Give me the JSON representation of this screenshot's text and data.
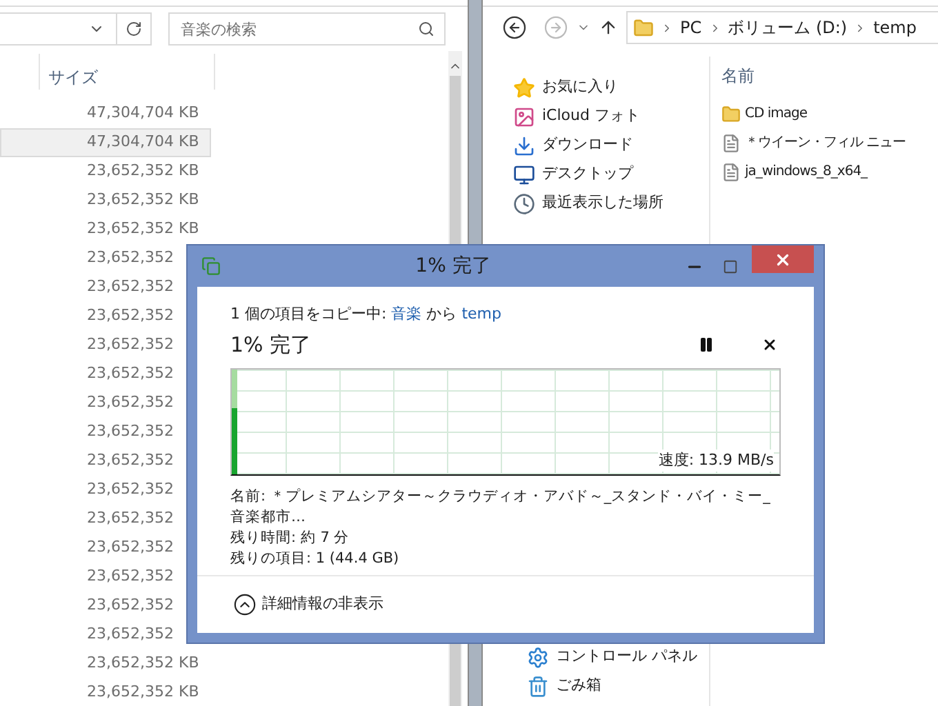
{
  "left_window": {
    "search": {
      "placeholder": "音楽の検索"
    },
    "column": "サイズ",
    "rows": [
      {
        "size": "47,304,704 KB",
        "selected": false
      },
      {
        "size": "47,304,704 KB",
        "selected": true
      },
      {
        "size": "23,652,352 KB",
        "selected": false
      },
      {
        "size": "23,652,352 KB",
        "selected": false
      },
      {
        "size": "23,652,352 KB",
        "selected": false
      },
      {
        "size": "23,652,352",
        "selected": false
      },
      {
        "size": "23,652,352",
        "selected": false
      },
      {
        "size": "23,652,352",
        "selected": false
      },
      {
        "size": "23,652,352",
        "selected": false
      },
      {
        "size": "23,652,352",
        "selected": false
      },
      {
        "size": "23,652,352",
        "selected": false
      },
      {
        "size": "23,652,352",
        "selected": false
      },
      {
        "size": "23,652,352",
        "selected": false
      },
      {
        "size": "23,652,352",
        "selected": false
      },
      {
        "size": "23,652,352",
        "selected": false
      },
      {
        "size": "23,652,352",
        "selected": false
      },
      {
        "size": "23,652,352",
        "selected": false
      },
      {
        "size": "23,652,352",
        "selected": false
      },
      {
        "size": "23,652,352",
        "selected": false
      },
      {
        "size": "23,652,352 KB",
        "selected": false
      },
      {
        "size": "23,652,352 KB",
        "selected": false
      }
    ]
  },
  "right_window": {
    "breadcrumb": [
      "PC",
      "ボリューム (D:)",
      "temp"
    ],
    "column": "名前",
    "nav_top": [
      {
        "label": "お気に入り",
        "kind": "star"
      },
      {
        "label": "iCloud フォト",
        "kind": "photos"
      },
      {
        "label": "ダウンロード",
        "kind": "download"
      },
      {
        "label": "デスクトップ",
        "kind": "desktop"
      },
      {
        "label": "最近表示した場所",
        "kind": "recent"
      }
    ],
    "nav_bottom": [
      {
        "label": "コントロール パネル",
        "kind": "control"
      },
      {
        "label": "ごみ箱",
        "kind": "trash"
      }
    ],
    "files": [
      {
        "name": "CD image",
        "kind": "folder"
      },
      {
        "name": "＊ウイーン・フィル ニュー",
        "kind": "file"
      },
      {
        "name": "ja_windows_8_x64_",
        "kind": "file"
      }
    ]
  },
  "dialog": {
    "title": "1% 完了",
    "copying": {
      "prefix": "1 個の項目をコピー中: ",
      "source": "音楽",
      "middle": " から ",
      "target": "temp"
    },
    "percent": "1% 完了",
    "level": 0.01,
    "speed": "速度: 13.9 MB/s",
    "details": [
      "名前:  ＊プレミアムシアター～クラウディオ・アバド～_スタンド・バイ・ミー_音楽都市…",
      "残り時間: 約 7 分",
      "残りの項目: 1 (44.4 GB)"
    ],
    "toggle": "詳細情報の非表示"
  }
}
